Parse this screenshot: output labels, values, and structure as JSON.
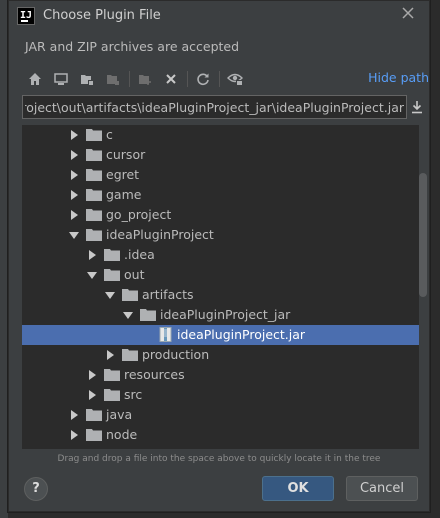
{
  "dialog": {
    "title": "Choose Plugin File",
    "description": "JAR and ZIP archives are accepted",
    "hide_path_label": "Hide path",
    "path_value": "C:\\Users\\Administrator\\ideaPluginProject\\out\\artifacts\\ideaPluginProject_jar\\ideaPluginProject.jar",
    "hint": "Drag and drop a file into the space above to quickly locate it in the tree",
    "ok_label": "OK",
    "cancel_label": "Cancel",
    "help_label": "?"
  },
  "toolbar": {
    "icons": [
      "home-icon",
      "desktop-icon",
      "project-folder-icon",
      "module-folder-icon",
      "new-folder-icon",
      "delete-icon",
      "refresh-icon",
      "show-hidden-icon"
    ]
  },
  "tree": {
    "items": [
      {
        "label": "c",
        "expanded": false,
        "type": "folder"
      },
      {
        "label": "cursor",
        "expanded": false,
        "type": "folder"
      },
      {
        "label": "egret",
        "expanded": false,
        "type": "folder"
      },
      {
        "label": "game",
        "expanded": false,
        "type": "folder"
      },
      {
        "label": "go_project",
        "expanded": false,
        "type": "folder"
      },
      {
        "label": "ideaPluginProject",
        "expanded": true,
        "type": "folder"
      },
      {
        "label": ".idea",
        "expanded": false,
        "type": "folder"
      },
      {
        "label": "out",
        "expanded": true,
        "type": "folder"
      },
      {
        "label": "artifacts",
        "expanded": true,
        "type": "folder"
      },
      {
        "label": "ideaPluginProject_jar",
        "expanded": true,
        "type": "folder"
      },
      {
        "label": "ideaPluginProject.jar",
        "expanded": false,
        "type": "jar",
        "selected": true
      },
      {
        "label": "production",
        "expanded": false,
        "type": "folder"
      },
      {
        "label": "resources",
        "expanded": false,
        "type": "folder"
      },
      {
        "label": "src",
        "expanded": false,
        "type": "folder"
      },
      {
        "label": "java",
        "expanded": false,
        "type": "folder"
      },
      {
        "label": "node",
        "expanded": false,
        "type": "folder"
      }
    ]
  },
  "colors": {
    "accent": "#589df6",
    "selection": "#4b6eaf",
    "ok_button": "#365880",
    "folder": "#afb1b3"
  }
}
